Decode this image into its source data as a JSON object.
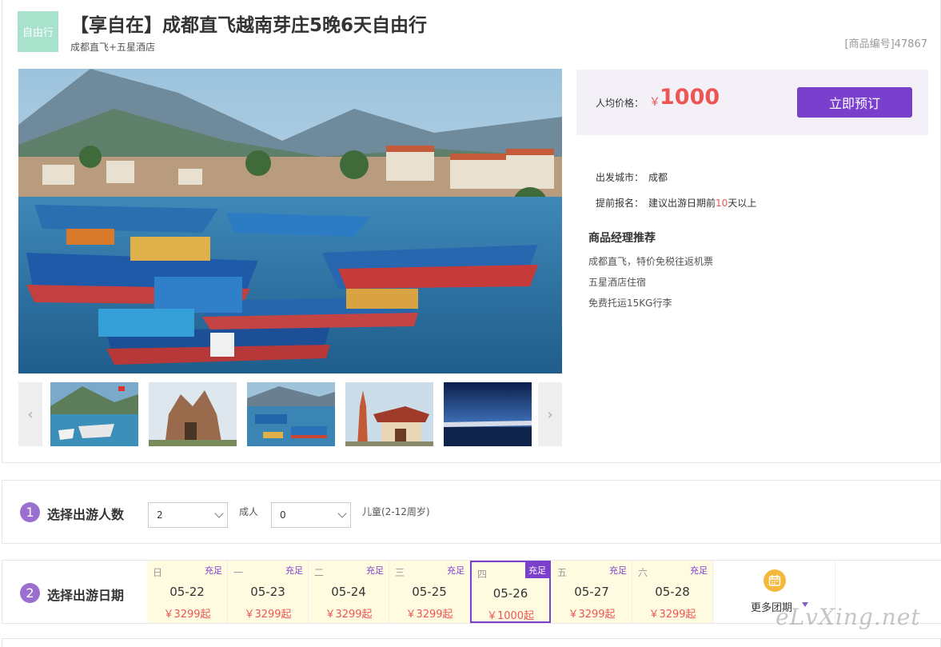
{
  "header": {
    "tag": "自由行",
    "title": "【享自在】成都直飞越南芽庄5晚6天自由行",
    "subtitle": "成都直飞+五星酒店",
    "product_code": "[商品编号]47867"
  },
  "gallery": {
    "prev_icon": "chevron-left-icon",
    "next_icon": "chevron-right-icon",
    "prev_glyph": "‹",
    "next_glyph": "›",
    "thumbnails": [
      "beach-boats-photo",
      "cham-tower-photo",
      "harbor-boats-photo",
      "pagoda-photo",
      "sunset-sea-photo"
    ]
  },
  "price": {
    "label": "人均价格：",
    "currency": "￥",
    "value": "1000",
    "book_button": "立即预订"
  },
  "info": {
    "departure_label": "出发城市：",
    "departure_value": "成都",
    "advance_label": "提前报名：",
    "advance_prefix": "建议出游日期前",
    "advance_days": "10",
    "advance_suffix": "天以上"
  },
  "recommend": {
    "title": "商品经理推荐",
    "items": [
      "成都直飞，特价免税往返机票",
      "五星酒店住宿",
      "免费托运15KG行李"
    ]
  },
  "step1": {
    "num": "1",
    "label": "选择出游人数",
    "adults_value": "2",
    "adults_label": "成人",
    "children_value": "0",
    "children_label": "儿童(2-12周岁)"
  },
  "step2": {
    "num": "2",
    "label": "选择出游日期",
    "days": [
      {
        "weekday": "日",
        "status": "充足",
        "date": "05-22",
        "price": "￥3299起"
      },
      {
        "weekday": "一",
        "status": "充足",
        "date": "05-23",
        "price": "￥3299起"
      },
      {
        "weekday": "二",
        "status": "充足",
        "date": "05-24",
        "price": "￥3299起"
      },
      {
        "weekday": "三",
        "status": "充足",
        "date": "05-25",
        "price": "￥3299起"
      },
      {
        "weekday": "四",
        "status": "充足",
        "date": "05-26",
        "price": "￥1000起"
      },
      {
        "weekday": "五",
        "status": "充足",
        "date": "05-27",
        "price": "￥3299起"
      },
      {
        "weekday": "六",
        "status": "充足",
        "date": "05-28",
        "price": "￥3299起"
      }
    ],
    "selected_index": 4,
    "more_label": "更多团期",
    "more_icon": "calendar-icon"
  },
  "watermark": "eLvXing.net",
  "colors": {
    "accent": "#7a3fcc",
    "price": "#e55555",
    "tag_bg": "#a8e2cc",
    "day_bg": "#fffbe1"
  }
}
